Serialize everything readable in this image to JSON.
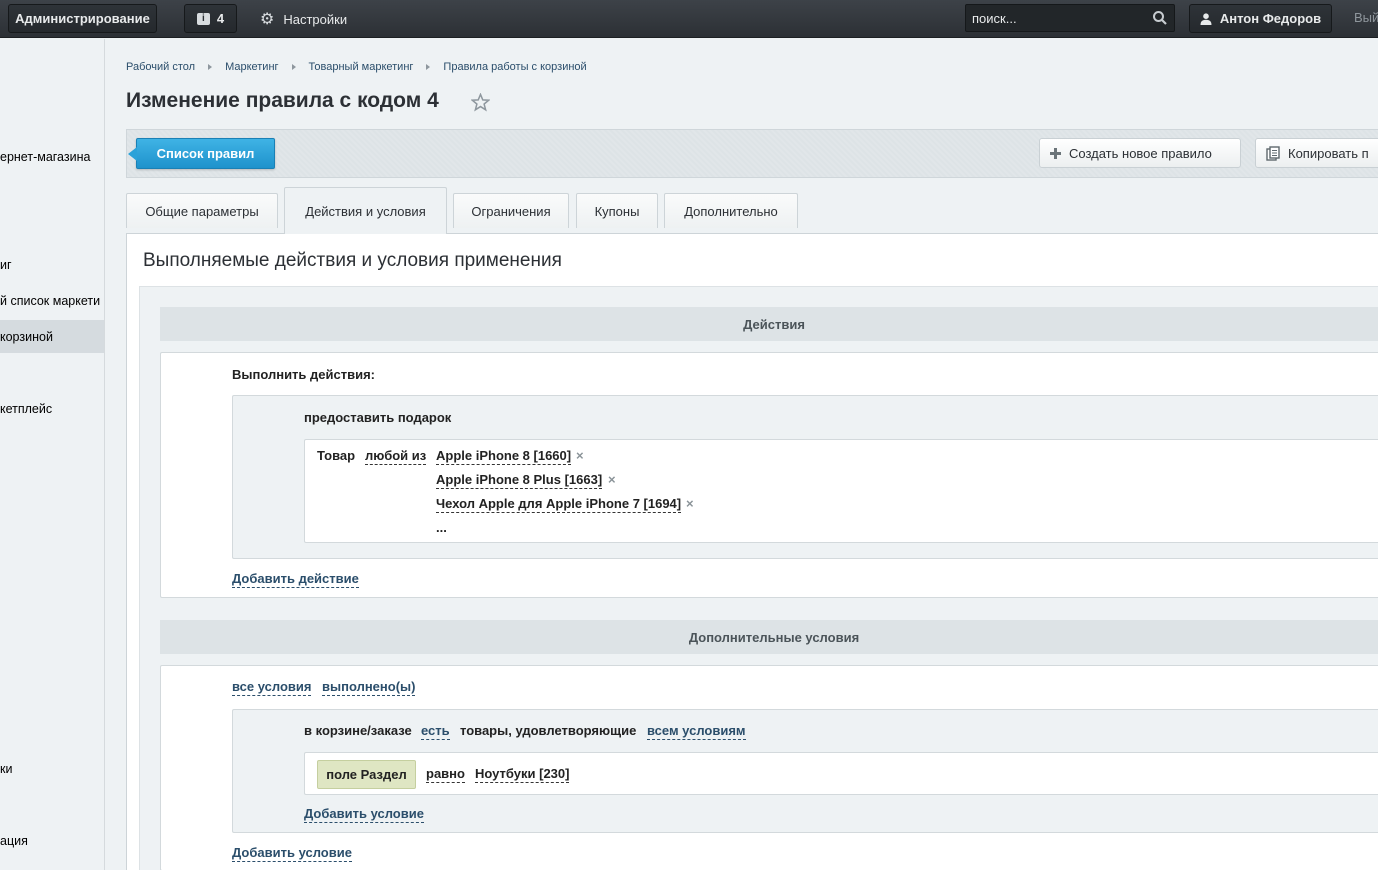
{
  "topbar": {
    "admin_label": "Администрирование",
    "notifications_count": "4",
    "settings_label": "Настройки",
    "search_placeholder": "поиск...",
    "user_name": "Антон Федоров",
    "logout_label": "Вый"
  },
  "left_menu": {
    "items": [
      {
        "label": "ернет-магазина",
        "active": false
      },
      {
        "label": "иг",
        "active": false
      },
      {
        "label": "й список маркети",
        "active": false
      },
      {
        "label": "корзиной",
        "active": true
      },
      {
        "label": "кетплейс",
        "active": false
      },
      {
        "label": "ки",
        "active": false
      },
      {
        "label": "ация",
        "active": false
      }
    ]
  },
  "breadcrumb": [
    "Рабочий стол",
    "Маркетинг",
    "Товарный маркетинг",
    "Правила работы с корзиной"
  ],
  "page_title": "Изменение правила с кодом 4",
  "toolbar": {
    "list_label": "Список правил",
    "create_label": "Создать новое правило",
    "copy_label": "Копировать п"
  },
  "tabs": [
    {
      "label": "Общие параметры",
      "active": false
    },
    {
      "label": "Действия и условия",
      "active": true
    },
    {
      "label": "Ограничения",
      "active": false
    },
    {
      "label": "Купоны",
      "active": false
    },
    {
      "label": "Дополнительно",
      "active": false
    }
  ],
  "content": {
    "title": "Выполняемые действия и условия применения",
    "actions": {
      "header": "Действия",
      "execute_label": "Выполнить действия:",
      "gift_label": "предоставить подарок",
      "product_label": "Товар",
      "any_of_label": "любой из",
      "products": [
        "Apple iPhone 8 [1660]",
        "Apple iPhone 8 Plus [1663]",
        "Чехол Apple для Apple iPhone 7 [1694]"
      ],
      "more": "...",
      "add_action": "Добавить действие"
    },
    "conditions": {
      "header": "Дополнительные условия",
      "all_conditions": "все условия",
      "fulfilled": "выполнено(ы)",
      "in_cart": "в корзине/заказе",
      "exists": "есть",
      "matching": "товары, удовлетворяющие",
      "all_cond": "всем условиям",
      "field": "поле Раздел",
      "equals": "равно",
      "value": "Ноутбуки [230]",
      "add_inner": "Добавить условие",
      "add_outer": "Добавить условие"
    }
  },
  "colors": {
    "topbar": "#34393e",
    "accent_blue": "#2aa2d9",
    "link": "#2b4e6b",
    "field_tag": "#dfe6c3"
  }
}
